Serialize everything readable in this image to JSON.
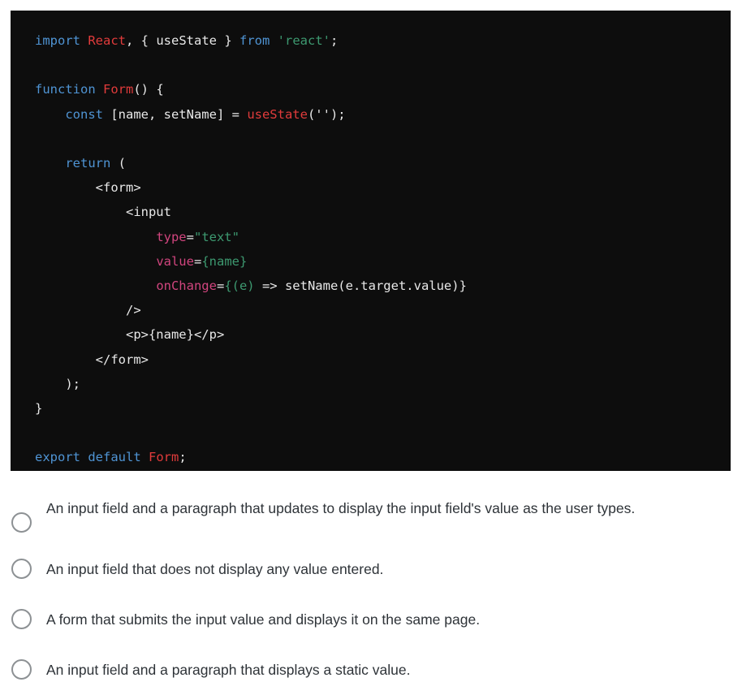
{
  "code_block": {
    "language": "jsx",
    "background_color": "#0d0d0d",
    "colors": {
      "keyword": "#4f94d4",
      "class": "#e13b3b",
      "string": "#3d9970",
      "attribute": "#d1457e",
      "plain": "#e8e8e8"
    },
    "lines": {
      "l1_import": "import ",
      "l1_react": "React",
      "l1_comma_brace": ", { useState } ",
      "l1_from": "from ",
      "l1_module": "'react'",
      "l1_semi": ";",
      "l3_function": "function ",
      "l3_name": "Form",
      "l3_rest": "() {",
      "l4_indent": "    ",
      "l4_const": "const ",
      "l4_decl": "[name, setName] = ",
      "l4_usestate": "useState",
      "l4_args": "('');",
      "l6_indent": "    ",
      "l6_return": "return ",
      "l6_paren": "(",
      "l7_form_open": "        <form>",
      "l8_input_open": "            <input",
      "l9_indent": "                ",
      "l9_attr": "type",
      "l9_eq": "=",
      "l9_val": "\"text\"",
      "l10_indent": "                ",
      "l10_attr": "value",
      "l10_eq": "=",
      "l10_val": "{name}",
      "l11_indent": "                ",
      "l11_attr": "onChange",
      "l11_eq": "=",
      "l11_brace_open": "{(e)",
      "l11_body": " => setName(e.target.value)}",
      "l12_selfclose": "            />",
      "l13_paragraph": "            <p>{name}</p>",
      "l14_form_close": "        </form>",
      "l15_close_paren": "    );",
      "l16_close_brace": "}",
      "l18_export": "export default ",
      "l18_name": "Form",
      "l18_semi": ";"
    }
  },
  "question": {
    "options": [
      {
        "id": "option-a",
        "label": "An input field and a paragraph that updates to display the input field's value as the user types.",
        "selected": false
      },
      {
        "id": "option-b",
        "label": "An input field that does not display any value entered.",
        "selected": false
      },
      {
        "id": "option-c",
        "label": "A form that submits the input value and displays it on the same page.",
        "selected": false
      },
      {
        "id": "option-d",
        "label": "An input field and a paragraph that displays a static value.",
        "selected": false
      }
    ]
  }
}
